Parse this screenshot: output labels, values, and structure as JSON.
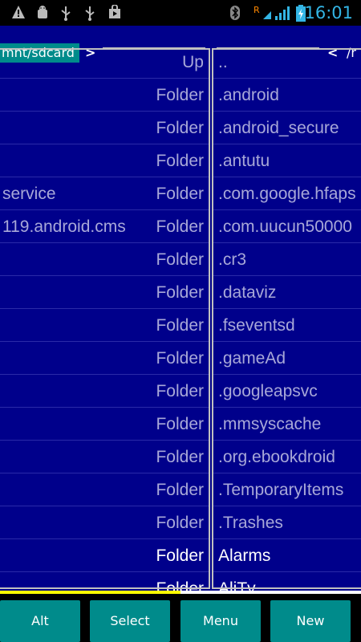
{
  "status_bar": {
    "time": "16:01",
    "left_icons": [
      "warning-icon",
      "android-debug-icon",
      "usb-icon",
      "usb-icon",
      "shopping-bag-icon"
    ],
    "right_icons": [
      "bluetooth-icon",
      "data-roaming-icon",
      "signal-icon",
      "battery-charging-icon"
    ],
    "roaming_label": "R"
  },
  "left_pane": {
    "path": "mnt/sdcard",
    "chevron": ">",
    "rows": [
      {
        "name": "",
        "type": "Up"
      },
      {
        "name": "",
        "type": "Folder"
      },
      {
        "name": "",
        "type": "Folder"
      },
      {
        "name": "",
        "type": "Folder"
      },
      {
        "name": "service",
        "type": "Folder"
      },
      {
        "name": "119.android.cms",
        "type": "Folder"
      },
      {
        "name": "",
        "type": "Folder"
      },
      {
        "name": "",
        "type": "Folder"
      },
      {
        "name": "",
        "type": "Folder"
      },
      {
        "name": "",
        "type": "Folder"
      },
      {
        "name": "",
        "type": "Folder"
      },
      {
        "name": "",
        "type": "Folder"
      },
      {
        "name": "",
        "type": "Folder"
      },
      {
        "name": "",
        "type": "Folder"
      },
      {
        "name": "",
        "type": "Folder"
      },
      {
        "name": "",
        "type": "Folder"
      },
      {
        "name": "",
        "type": "Folder"
      }
    ]
  },
  "right_pane": {
    "chevron": "<",
    "path": "/r",
    "rows": [
      {
        "name": ".."
      },
      {
        "name": ".android"
      },
      {
        "name": ".android_secure"
      },
      {
        "name": ".antutu"
      },
      {
        "name": ".com.google.hfaps"
      },
      {
        "name": ".com.uucun50000"
      },
      {
        "name": ".cr3"
      },
      {
        "name": ".dataviz"
      },
      {
        "name": ".fseventsd"
      },
      {
        "name": ".gameAd"
      },
      {
        "name": ".googleapsvc"
      },
      {
        "name": ".mmsyscache"
      },
      {
        "name": ".org.ebookdroid"
      },
      {
        "name": ".TemporaryItems"
      },
      {
        "name": ".Trashes"
      },
      {
        "name": "Alarms"
      },
      {
        "name": "AliTv"
      }
    ]
  },
  "scroll_position": 0.5,
  "buttons": {
    "alt": "Alt",
    "select": "Select",
    "menu": "Menu",
    "new": "New"
  },
  "colors": {
    "pane_background": "#00008b",
    "accent_button": "#008b8b",
    "progress": "#ffff00",
    "time": "#33b5e5"
  }
}
